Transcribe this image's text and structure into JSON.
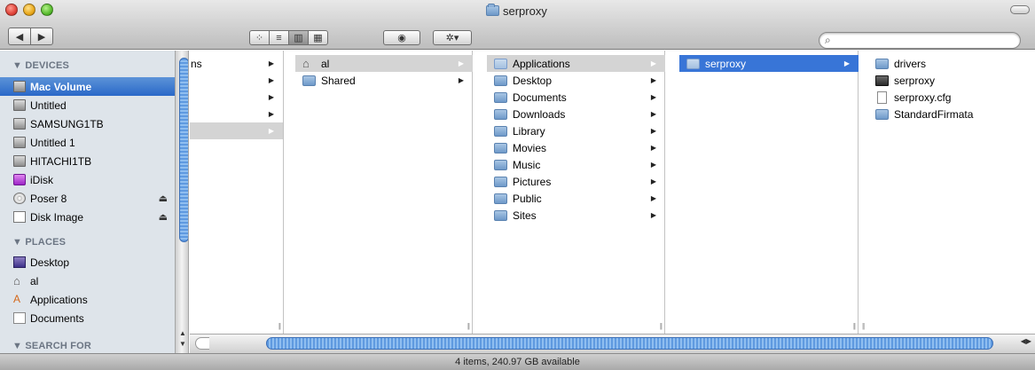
{
  "window": {
    "title": "serproxy"
  },
  "toolbar": {
    "back_glyph": "◀",
    "forward_glyph": "▶",
    "view_icons": [
      "⁘",
      "≡",
      "▥",
      "▦"
    ],
    "quicklook_glyph": "◉",
    "action_glyph": "✲▾",
    "search_placeholder": "",
    "search_glyph": "⌕"
  },
  "sidebar": {
    "devices_header": "▼ DEVICES",
    "devices": [
      {
        "label": "Mac Volume",
        "icon": "hard-drive-icon",
        "selected": true
      },
      {
        "label": "Untitled",
        "icon": "hard-drive-icon"
      },
      {
        "label": "SAMSUNG1TB",
        "icon": "hard-drive-icon"
      },
      {
        "label": "Untitled 1",
        "icon": "hard-drive-icon"
      },
      {
        "label": "HITACHI1TB",
        "icon": "hard-drive-icon"
      },
      {
        "label": "iDisk",
        "icon": "idisk-icon"
      },
      {
        "label": "Poser 8",
        "icon": "cd-icon",
        "eject": "⏏"
      },
      {
        "label": "Disk Image",
        "icon": "disk-image-icon",
        "eject": "⏏"
      }
    ],
    "places_header": "▼ PLACES",
    "places": [
      {
        "label": "Desktop",
        "icon": "desktop-icon"
      },
      {
        "label": "al",
        "icon": "home-icon"
      },
      {
        "label": "Applications",
        "icon": "applications-icon"
      },
      {
        "label": "Documents",
        "icon": "documents-icon"
      }
    ],
    "search_header": "▼ SEARCH FOR"
  },
  "columns": {
    "col0": {
      "partial_text": "ns",
      "arrow": "▶"
    },
    "col1": [
      {
        "label": "al",
        "icon": "home-icon",
        "selected": "gray"
      },
      {
        "label": "Shared",
        "icon": "folder-icon"
      }
    ],
    "col2": [
      {
        "label": "Applications",
        "icon": "applications-folder-icon",
        "selected": "gray"
      },
      {
        "label": "Desktop",
        "icon": "folder-icon"
      },
      {
        "label": "Documents",
        "icon": "documents-folder-icon"
      },
      {
        "label": "Downloads",
        "icon": "downloads-folder-icon"
      },
      {
        "label": "Library",
        "icon": "library-folder-icon"
      },
      {
        "label": "Movies",
        "icon": "movies-folder-icon"
      },
      {
        "label": "Music",
        "icon": "music-folder-icon"
      },
      {
        "label": "Pictures",
        "icon": "pictures-folder-icon"
      },
      {
        "label": "Public",
        "icon": "public-folder-icon"
      },
      {
        "label": "Sites",
        "icon": "sites-folder-icon"
      }
    ],
    "col3": [
      {
        "label": "serproxy",
        "icon": "folder-icon",
        "selected": "blue"
      }
    ],
    "col4": [
      {
        "label": "drivers",
        "icon": "folder-icon"
      },
      {
        "label": "serproxy",
        "icon": "unix-executable-icon"
      },
      {
        "label": "serproxy.cfg",
        "icon": "document-icon"
      },
      {
        "label": "StandardFirmata",
        "icon": "folder-icon"
      }
    ],
    "arrow_glyph": "▶",
    "grip_glyph": "||"
  },
  "status_bar": {
    "text": "4 items, 240.97 GB available"
  },
  "colors": {
    "selection_blue": "#3875d7",
    "selection_gray": "#d4d4d4",
    "sidebar_bg": "#dee4ea"
  }
}
